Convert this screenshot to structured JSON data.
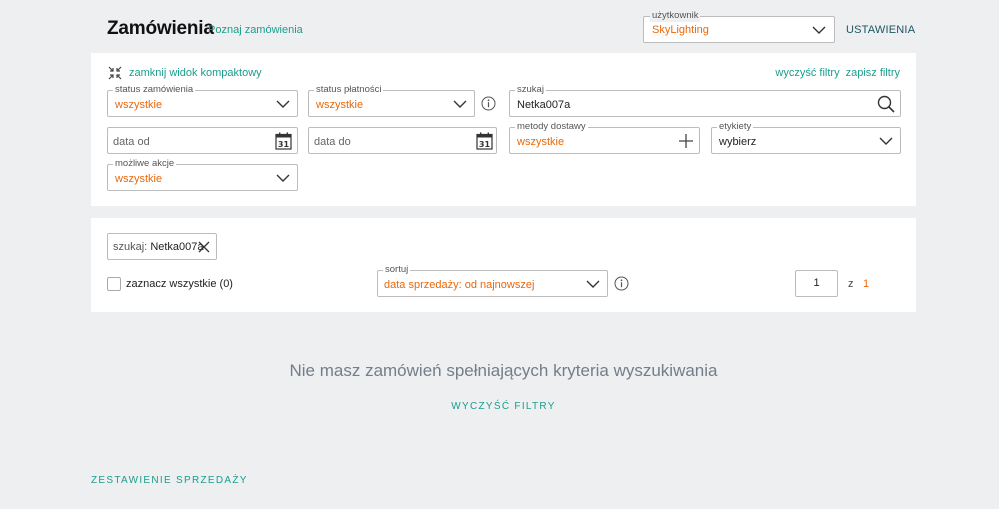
{
  "header": {
    "title": "Zamówienia",
    "learn_link": "Poznaj zamówienia",
    "user_legend": "użytkownik",
    "user_value": "SkyLighting",
    "settings": "USTAWIENIA"
  },
  "filters": {
    "compact_toggle": "zamknij widok kompaktowy",
    "clear_filters": "wyczyść filtry",
    "save_filters": "zapisz filtry",
    "order_status_legend": "status zamówienia",
    "order_status_value": "wszystkie",
    "payment_status_legend": "status płatności",
    "payment_status_value": "wszystkie",
    "search_legend": "szukaj",
    "search_value": "Netka007a",
    "date_from_placeholder": "data od",
    "date_to_placeholder": "data do",
    "calendar_day": "31",
    "delivery_legend": "metody dostawy",
    "delivery_value": "wszystkie",
    "labels_legend": "etykiety",
    "labels_value": "wybierz",
    "actions_legend": "możliwe akcje",
    "actions_value": "wszystkie"
  },
  "results": {
    "chip_key": "szukaj:",
    "chip_value": "Netka007a",
    "select_all": "zaznacz wszystkie (0)",
    "sort_legend": "sortuj",
    "sort_value": "data sprzedaży: od najnowszej",
    "page_current": "1",
    "page_of": "z",
    "page_total": "1"
  },
  "empty_state": {
    "message": "Nie masz zamówień spełniających kryteria wyszukiwania",
    "clear_button": "WYCZYŚĆ FILTRY"
  },
  "footer": {
    "sales_summary": "ZESTAWIENIE SPRZEDAŻY"
  },
  "colors": {
    "accent": "#1a9e8c",
    "value_orange": "#e8690d",
    "background": "#eeeff1"
  }
}
